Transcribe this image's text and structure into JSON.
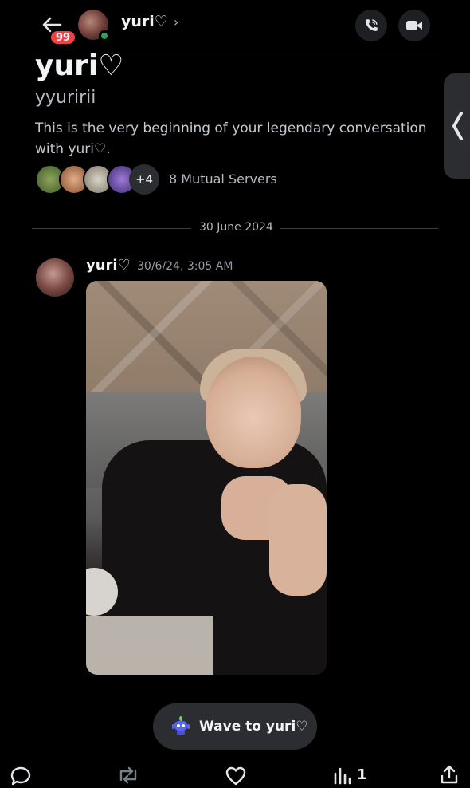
{
  "header": {
    "unread_badge": "99",
    "name": "yuri♡",
    "chevron": "›"
  },
  "profile": {
    "display_name": "yuri♡",
    "username": "yyuririi",
    "intro": "This is the very beginning of your legendary conversation with yuri♡.",
    "mutual_extra": "+4",
    "mutual_servers": "8 Mutual Servers"
  },
  "divider_date": "30 June 2024",
  "message": {
    "author": "yuri♡",
    "timestamp": "30/6/24, 3:05 AM"
  },
  "wave_button": "Wave to yuri♡",
  "bottom_bar": {
    "view_count": "1"
  },
  "icons": {
    "back": "arrow-left-icon",
    "call": "phone-icon",
    "video": "video-camera-icon",
    "side_tab": "chevron-left-icon",
    "wave": "wave-bot-icon",
    "reply": "speech-bubble-icon",
    "repost": "repost-icon",
    "like": "heart-icon",
    "views": "bar-chart-icon",
    "share": "share-icon"
  },
  "colors": {
    "badge": "#f23f42",
    "online": "#23a55a",
    "background": "#000000",
    "pill": "#2b2d31"
  }
}
